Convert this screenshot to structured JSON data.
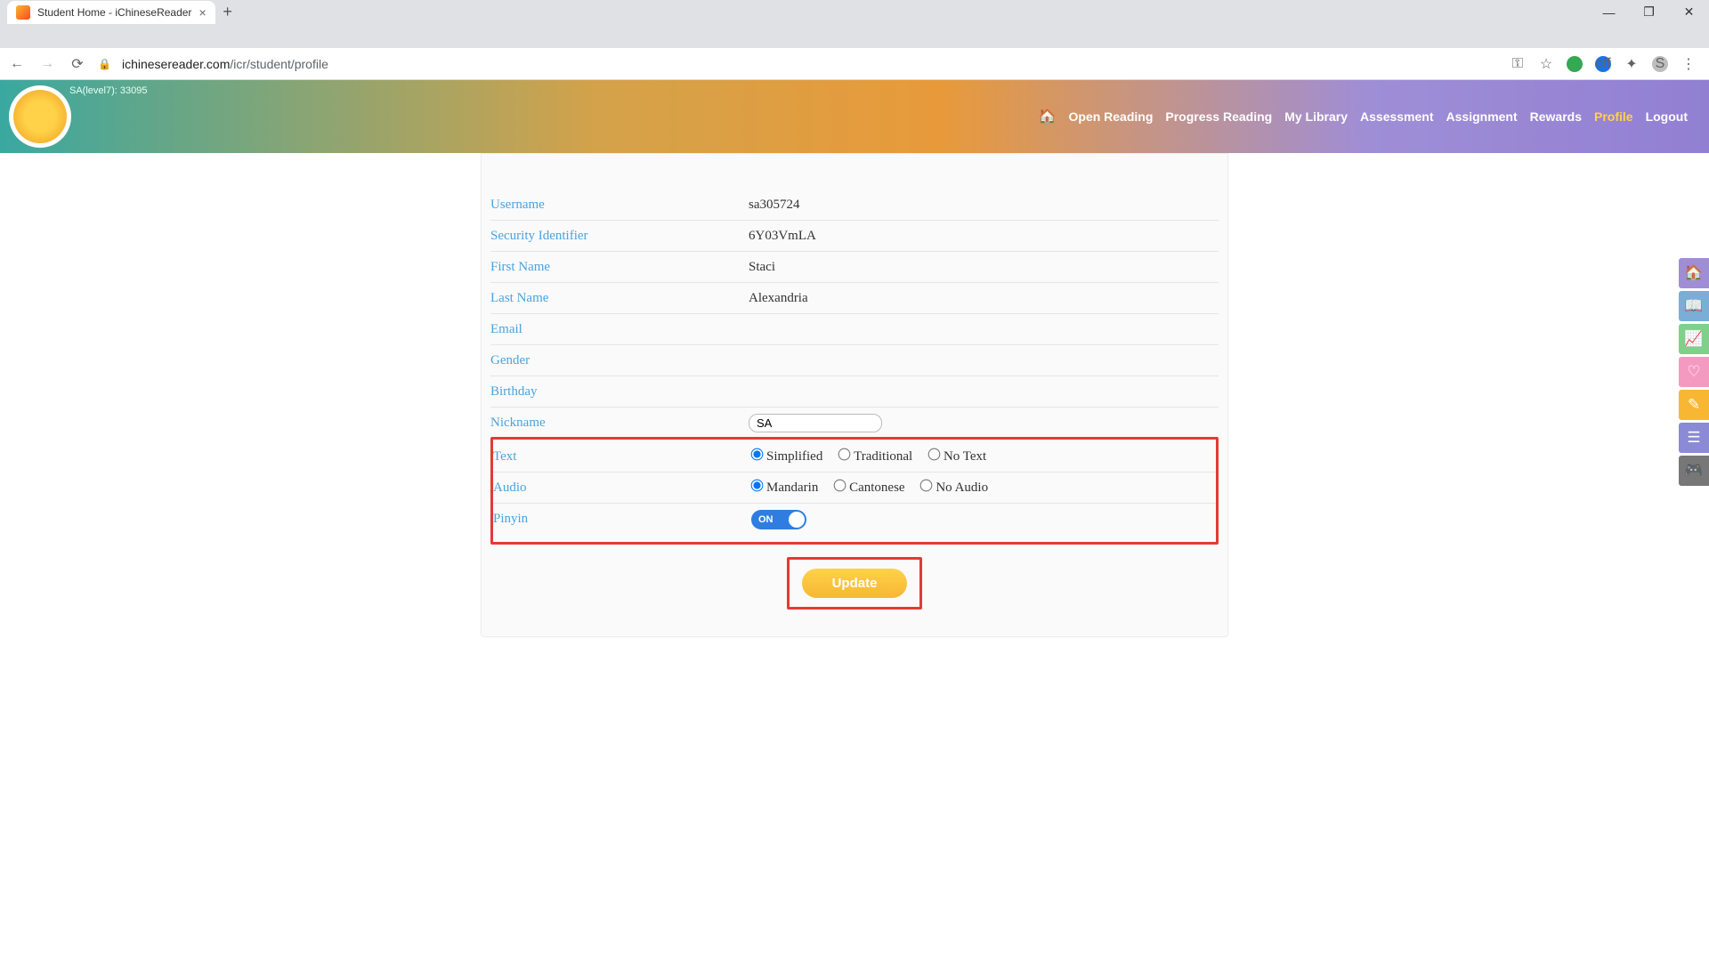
{
  "browser": {
    "tab_title": "Student Home - iChineseReader",
    "url_domain": "ichinesereader.com",
    "url_path": "/icr/student/profile"
  },
  "header": {
    "level_text": "SA(level7): 33095",
    "nav": {
      "open_reading": "Open Reading",
      "progress_reading": "Progress Reading",
      "my_library": "My Library",
      "assessment": "Assessment",
      "assignment": "Assignment",
      "rewards": "Rewards",
      "profile": "Profile",
      "logout": "Logout"
    }
  },
  "profile": {
    "labels": {
      "username": "Username",
      "security_identifier": "Security Identifier",
      "first_name": "First Name",
      "last_name": "Last Name",
      "email": "Email",
      "gender": "Gender",
      "birthday": "Birthday",
      "nickname": "Nickname",
      "text": "Text",
      "audio": "Audio",
      "pinyin": "Pinyin"
    },
    "values": {
      "username": "sa305724",
      "security_identifier": "6Y03VmLA",
      "first_name": "Staci",
      "last_name": "Alexandria",
      "email": "",
      "gender": "",
      "birthday": "",
      "nickname": "SA"
    },
    "text_options": {
      "simplified": "Simplified",
      "traditional": "Traditional",
      "no_text": "No Text",
      "selected": "simplified"
    },
    "audio_options": {
      "mandarin": "Mandarin",
      "cantonese": "Cantonese",
      "no_audio": "No Audio",
      "selected": "mandarin"
    },
    "pinyin_toggle": "ON",
    "update_btn": "Update"
  }
}
